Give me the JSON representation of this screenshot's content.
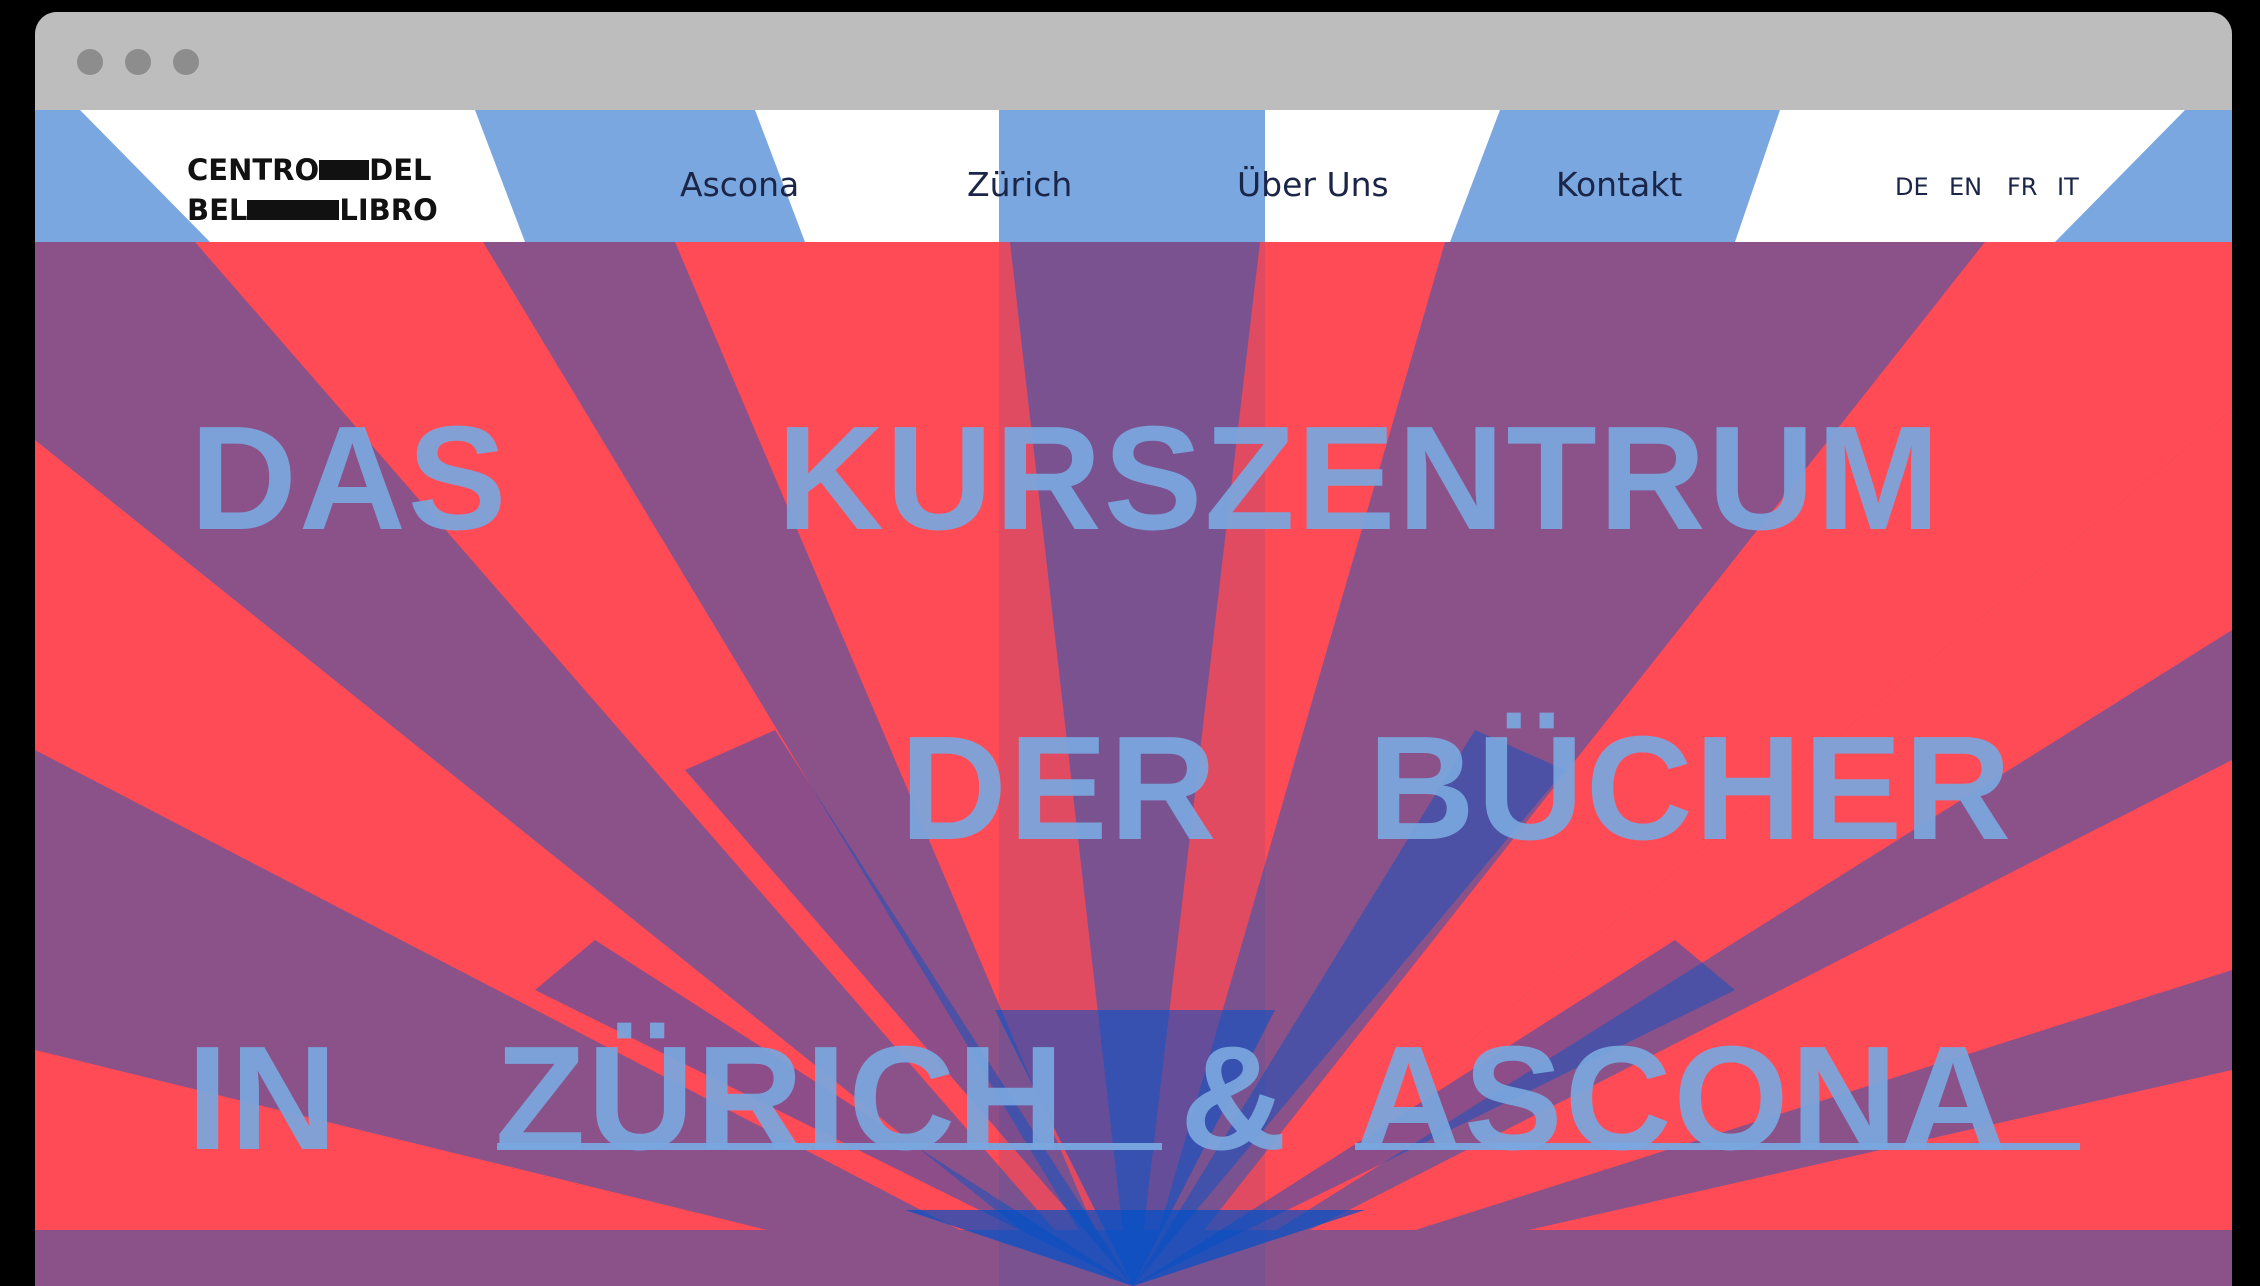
{
  "colors": {
    "background_purple": "#8b5289",
    "ray_red": "#ff4b55",
    "ray_blue": "#7aa7df",
    "header_white": "#ffffff",
    "deep_blue": "#0050c8",
    "text_dark": "#1b2547"
  },
  "logo": {
    "line1_left": "CENTRO",
    "line1_right": "DEL",
    "line2_left": "BEL",
    "line2_right": "LIBRO"
  },
  "nav": {
    "items": [
      {
        "label": "Ascona"
      },
      {
        "label": "Zürich"
      },
      {
        "label": "Über Uns"
      },
      {
        "label": "Kontakt"
      }
    ]
  },
  "languages": [
    "DE",
    "EN",
    "FR",
    "IT"
  ],
  "hero": {
    "line1": {
      "word1": "DAS",
      "word2": "KURSZENTRUM"
    },
    "line2": {
      "word1": "DER",
      "word2": "BÜCHER"
    },
    "line3": {
      "word1": "IN",
      "link1": "ZÜRICH",
      "amp": "&",
      "link2": "ASCONA"
    }
  }
}
